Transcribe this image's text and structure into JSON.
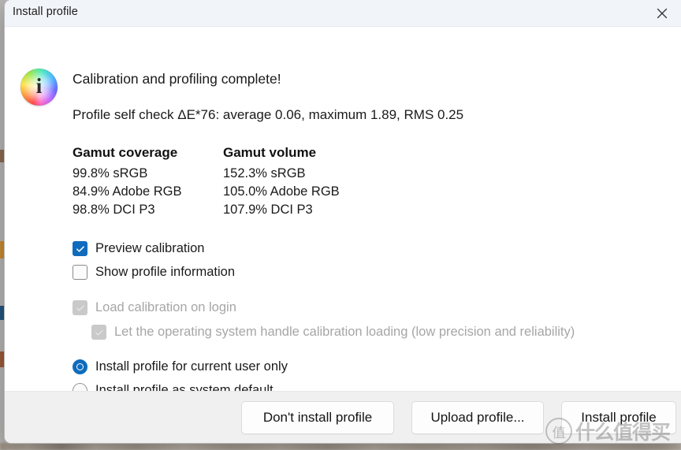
{
  "window": {
    "title": "Install profile",
    "close_icon": "close-x-icon"
  },
  "content": {
    "info_icon": "color-wheel-info-icon",
    "info_glyph": "i",
    "headline": "Calibration and profiling complete!",
    "self_check": "Profile self check ΔE*76: average 0.06, maximum 1.89, RMS 0.25"
  },
  "gamut": {
    "coverage_header": "Gamut coverage",
    "volume_header": "Gamut volume",
    "rows": [
      {
        "coverage": "99.8% sRGB",
        "volume": "152.3% sRGB"
      },
      {
        "coverage": "84.9% Adobe RGB",
        "volume": "105.0% Adobe RGB"
      },
      {
        "coverage": "98.8% DCI P3",
        "volume": "107.9% DCI P3"
      }
    ]
  },
  "options": {
    "preview_calibration": {
      "label": "Preview calibration",
      "checked": true,
      "enabled": true
    },
    "show_profile_information": {
      "label": "Show profile information",
      "checked": false,
      "enabled": true
    },
    "load_calibration_on_login": {
      "label": "Load calibration on login",
      "checked": true,
      "enabled": false
    },
    "os_handle_calibration": {
      "label": "Let the operating system handle calibration loading (low precision and reliability)",
      "checked": true,
      "enabled": false
    }
  },
  "install_scope": {
    "current_user": {
      "label": "Install profile for current user only",
      "selected": true
    },
    "system_default": {
      "label": "Install profile as system default",
      "selected": false
    }
  },
  "footer": {
    "dont_install_label": "Don't install profile",
    "upload_label": "Upload profile...",
    "install_label": "Install profile"
  },
  "watermark": {
    "badge": "值",
    "text": "什么值得买"
  },
  "colors": {
    "accent": "#0f6cbd",
    "title_bar": "#f1f4f8",
    "footer": "#f0f0f0",
    "disabled_text": "#a6a6a6"
  }
}
